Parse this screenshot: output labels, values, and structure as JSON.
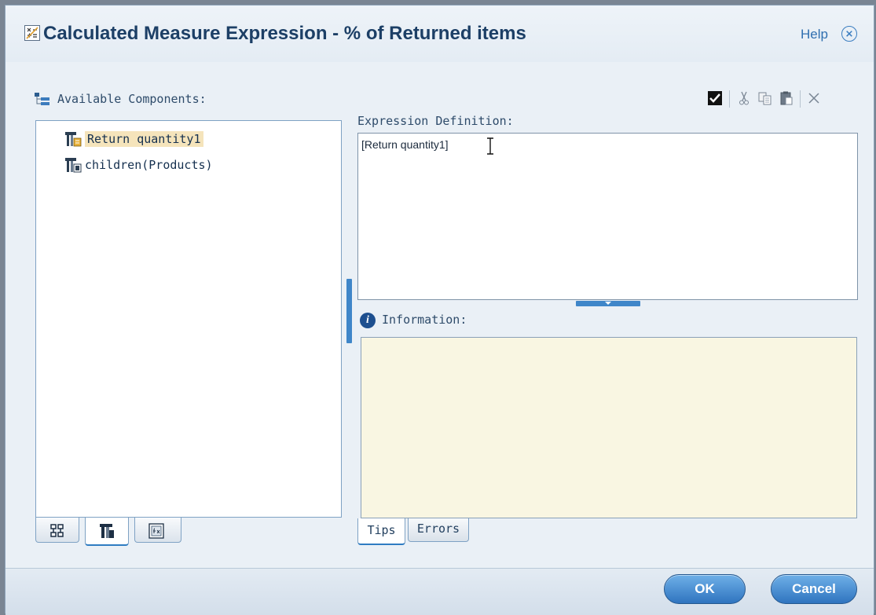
{
  "dialog": {
    "title": "Calculated Measure Expression - % of Returned items",
    "help_label": "Help",
    "close_glyph": "⨯"
  },
  "left_panel": {
    "label": "Available Components:",
    "tree": [
      {
        "label": "Return quantity1",
        "icon": "measure-icon",
        "selected": true
      },
      {
        "label": "children(Products)",
        "icon": "member-set-icon",
        "selected": false
      }
    ],
    "tabs": [
      {
        "name": "hierarchy-tab",
        "icon": "hierarchy-icon",
        "active": false
      },
      {
        "name": "measures-tab",
        "icon": "measure-icon",
        "active": true
      },
      {
        "name": "functions-tab",
        "icon": "function-icon",
        "active": false
      }
    ]
  },
  "expression": {
    "label": "Expression Definition:",
    "value": "[Return quantity1]"
  },
  "information": {
    "label": "Information:",
    "tabs": [
      {
        "label": "Tips",
        "active": true
      },
      {
        "label": "Errors",
        "active": false
      }
    ]
  },
  "toolbar": {
    "icons": [
      "validate-check-icon",
      "cut-icon",
      "copy-icon",
      "paste-icon",
      "delete-icon"
    ]
  },
  "footer": {
    "ok_label": "OK",
    "cancel_label": "Cancel"
  },
  "colors": {
    "title": "#1c3f66",
    "accent": "#2f74bf",
    "info_bg": "#f9f6e2",
    "selection": "#f5e4bb"
  }
}
